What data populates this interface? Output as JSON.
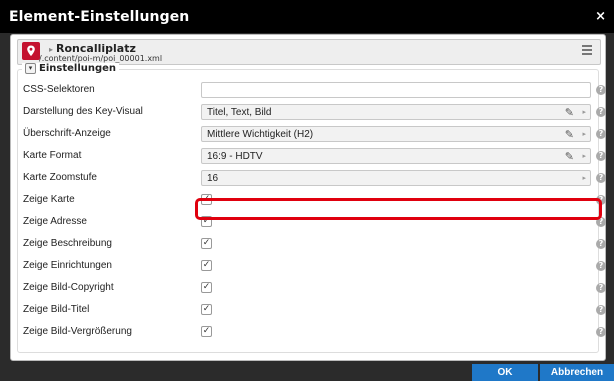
{
  "dialog": {
    "title": "Element-Einstellungen",
    "close": "×"
  },
  "resource": {
    "name": "Roncalliplatz",
    "path": "/.content/poi-m/poi_00001.xml",
    "icon": "map-pin-icon"
  },
  "section": {
    "title": "Einstellungen",
    "toggle": "▾"
  },
  "fields": [
    {
      "label": "CSS-Selektoren",
      "type": "input",
      "value": ""
    },
    {
      "label": "Darstellung des Key-Visual",
      "type": "select",
      "value": "Titel, Text, Bild"
    },
    {
      "label": "Überschrift-Anzeige",
      "type": "select",
      "value": "Mittlere Wichtigkeit (H2)"
    },
    {
      "label": "Karte Format",
      "type": "select",
      "value": "16:9 - HDTV"
    },
    {
      "label": "Karte Zoomstufe",
      "type": "select",
      "value": "16",
      "highlighted": true
    },
    {
      "label": "Zeige Karte",
      "type": "checkbox",
      "checked": true
    },
    {
      "label": "Zeige Adresse",
      "type": "checkbox",
      "checked": true
    },
    {
      "label": "Zeige Beschreibung",
      "type": "checkbox",
      "checked": true
    },
    {
      "label": "Zeige Einrichtungen",
      "type": "checkbox",
      "checked": true
    },
    {
      "label": "Zeige Bild-Copyright",
      "type": "checkbox",
      "checked": true
    },
    {
      "label": "Zeige Bild-Titel",
      "type": "checkbox",
      "checked": true
    },
    {
      "label": "Zeige Bild-Vergrößerung",
      "type": "checkbox",
      "checked": true
    }
  ],
  "symbols": {
    "help": "?",
    "check": "✓",
    "pencil": "✎",
    "caret": "▸",
    "arrow": "▸"
  },
  "buttons": {
    "ok": "OK",
    "cancel": "Abbrechen"
  },
  "colors": {
    "accent": "#1f78c8",
    "highlight": "#e0000e",
    "poi": "#c4122f",
    "titlebar": "#000000"
  }
}
